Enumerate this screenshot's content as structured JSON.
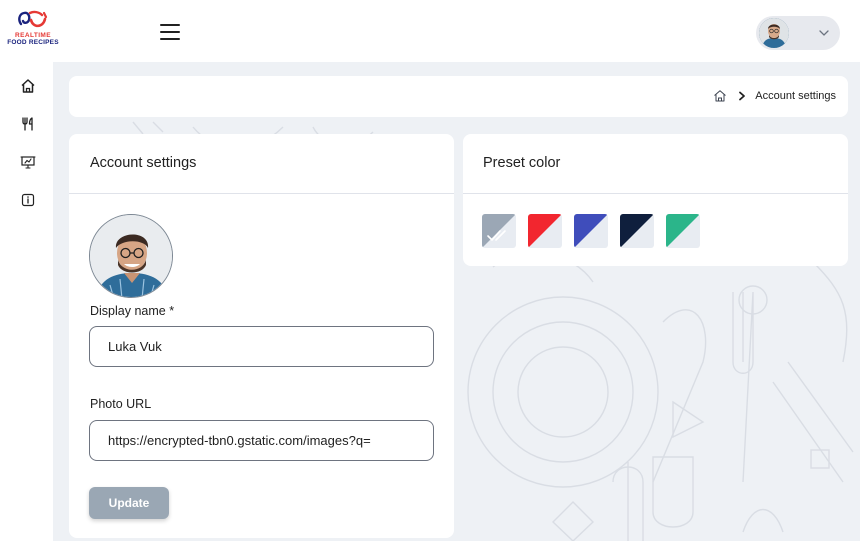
{
  "logo": {
    "line1": "REALTIME",
    "line2": "FOOD RECIPES"
  },
  "header": {
    "menu_icon": "hamburger-icon",
    "profile_chevron_icon": "chevron-down-icon"
  },
  "sidebar": {
    "items": [
      {
        "icon": "home-icon"
      },
      {
        "icon": "fork-knife-icon"
      },
      {
        "icon": "presentation-icon"
      },
      {
        "icon": "info-icon"
      }
    ]
  },
  "breadcrumb": {
    "home_icon": "home-icon",
    "separator_icon": "chevron-right-icon",
    "current": "Account settings"
  },
  "account_card": {
    "title": "Account settings",
    "display_name_label": "Display name *",
    "display_name_value": "Luka Vuk",
    "photo_url_label": "Photo URL",
    "photo_url_value": "https://encrypted-tbn0.gstatic.com/images?q=",
    "update_label": "Update"
  },
  "preset_card": {
    "title": "Preset color",
    "swatches": [
      {
        "name": "default",
        "color_a": "#9ba7b5",
        "color_b": "#e8ecf2",
        "selected": true
      },
      {
        "name": "red",
        "color_a": "#f2262f",
        "color_b": "#e8ecf2",
        "selected": false
      },
      {
        "name": "blue",
        "color_a": "#3f4dbb",
        "color_b": "#e8ecf2",
        "selected": false
      },
      {
        "name": "navy",
        "color_a": "#0f1f3d",
        "color_b": "#e8ecf2",
        "selected": false
      },
      {
        "name": "green",
        "color_a": "#2bb58a",
        "color_b": "#e8ecf2",
        "selected": false
      }
    ]
  },
  "colors": {
    "content_bg": "#eef1f5",
    "button_bg": "#9aa7b4",
    "brand_red": "#e53935",
    "brand_navy": "#1a237e"
  }
}
